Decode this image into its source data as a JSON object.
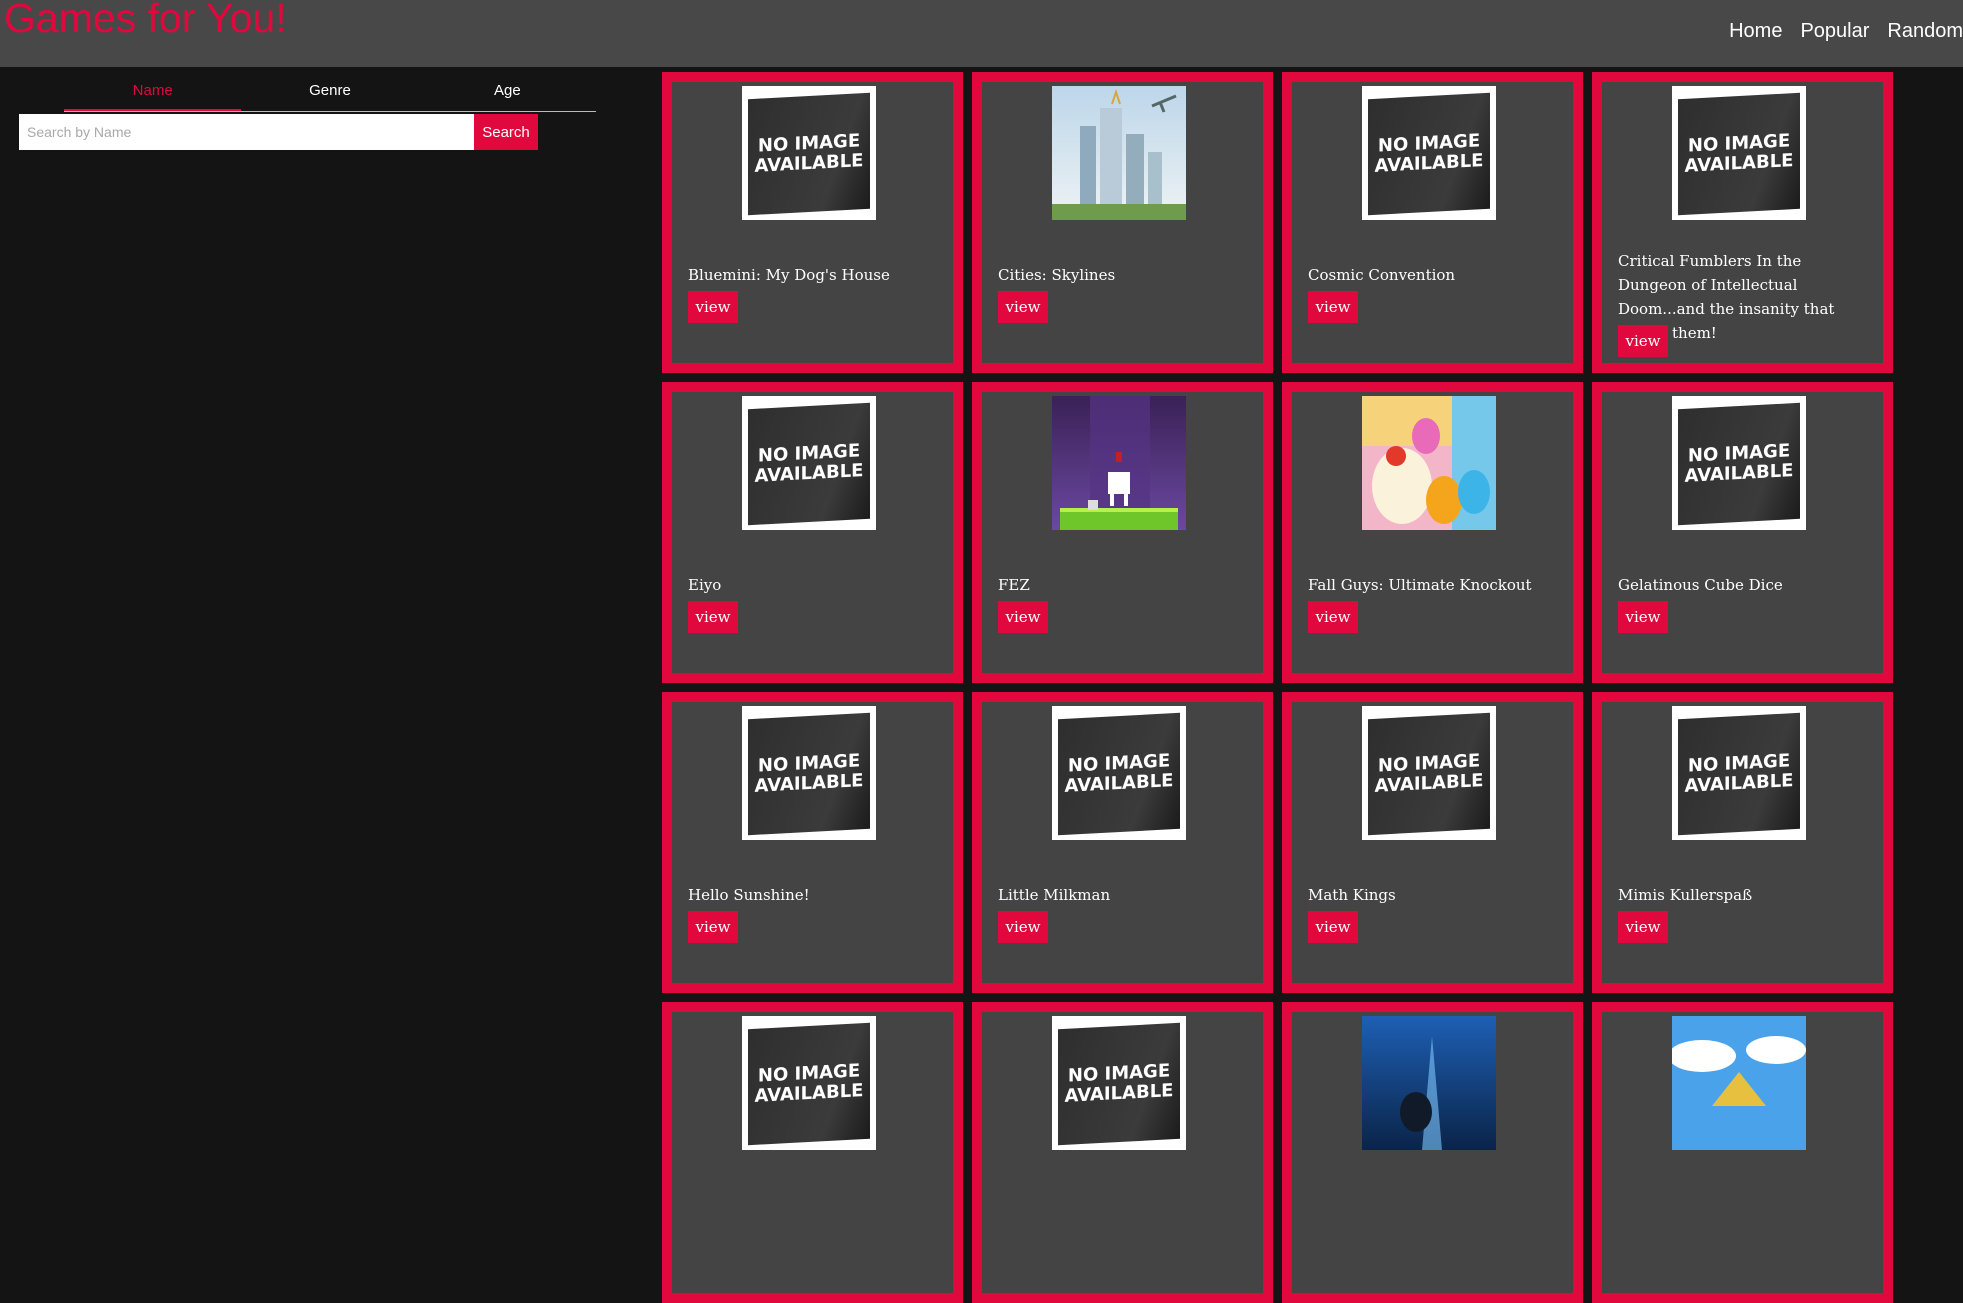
{
  "header": {
    "brand": "Games for You!",
    "nav": [
      "Home",
      "Popular",
      "Random"
    ]
  },
  "sidebar": {
    "tabs": [
      "Name",
      "Genre",
      "Age"
    ],
    "active_tab": "Name",
    "search": {
      "placeholder": "Search by Name",
      "value": "",
      "button": "Search"
    }
  },
  "no_image_text": [
    "NO IMAGE",
    "AVAILABLE"
  ],
  "view_label": "view",
  "accent_color": "#e0083d",
  "games": [
    {
      "title": "Bluemini: My Dog's House",
      "image": "none"
    },
    {
      "title": "Cities: Skylines",
      "image": "cities"
    },
    {
      "title": "Cosmic Convention",
      "image": "none"
    },
    {
      "title": "Critical Fumblers In the Dungeon of Intellectual Doom...and the insanity that awaits them!",
      "image": "none"
    },
    {
      "title": "Eiyo",
      "image": "none"
    },
    {
      "title": "FEZ",
      "image": "fez"
    },
    {
      "title": "Fall Guys: Ultimate Knockout",
      "image": "fallguys"
    },
    {
      "title": "Gelatinous Cube Dice",
      "image": "none"
    },
    {
      "title": "Hello Sunshine!",
      "image": "none"
    },
    {
      "title": "Little Milkman",
      "image": "none"
    },
    {
      "title": "Math Kings",
      "image": "none"
    },
    {
      "title": "Mimis Kullerspaß",
      "image": "none"
    },
    {
      "title": "",
      "image": "none"
    },
    {
      "title": "",
      "image": "none"
    },
    {
      "title": "",
      "image": "blue-art"
    },
    {
      "title": "",
      "image": "sky-art"
    }
  ]
}
